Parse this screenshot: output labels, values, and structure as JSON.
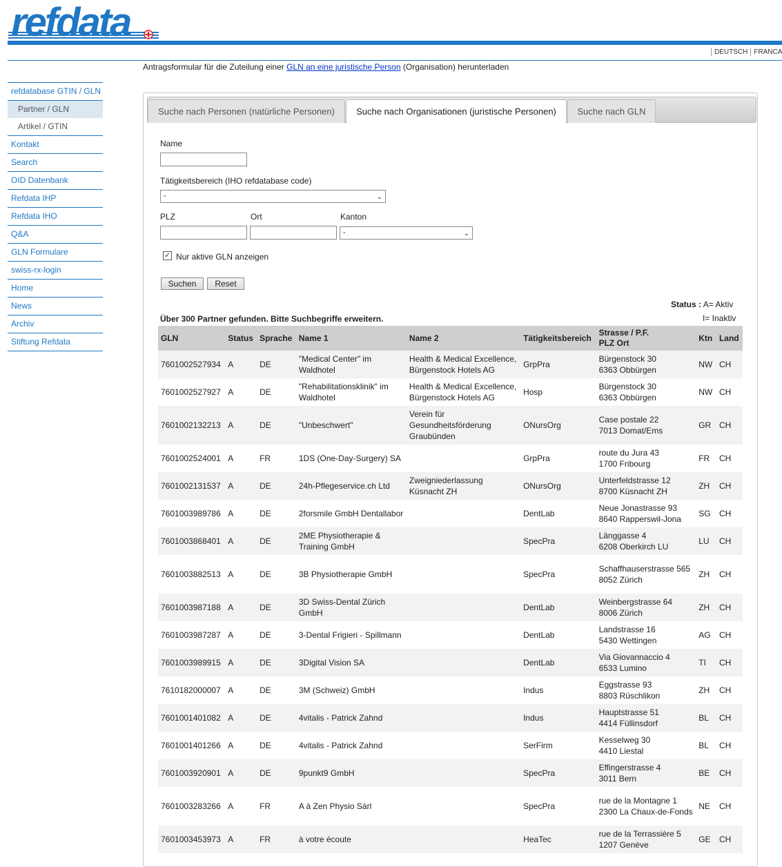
{
  "header": {
    "logo_text": "refdata",
    "languages": [
      "DEUTSCH",
      "FRANCAIS"
    ]
  },
  "download": {
    "prefix": "Antragsformular für die Zuteilung einer ",
    "link": "GLN an eine juristische Person",
    "suffix": " (Organisation) herunterladen"
  },
  "sidebar": {
    "items": [
      {
        "label": "refdatabase GTIN / GLN"
      },
      {
        "label": "Partner / GLN"
      },
      {
        "label": "Artikel / GTIN"
      },
      {
        "label": "Kontakt"
      },
      {
        "label": "Search"
      },
      {
        "label": "OID Datenbank"
      },
      {
        "label": "Refdata IHP"
      },
      {
        "label": "Refdata IHO"
      },
      {
        "label": "Q&A"
      },
      {
        "label": "GLN Formulare"
      },
      {
        "label": "swiss-rx-login"
      },
      {
        "label": "Home"
      },
      {
        "label": "News"
      },
      {
        "label": "Archiv"
      },
      {
        "label": "Stiftung Refdata"
      }
    ]
  },
  "tabs": [
    {
      "label": "Suche nach Personen (natürliche Personen)"
    },
    {
      "label": "Suche nach Organisationen (juristische Personen)"
    },
    {
      "label": "Suche nach GLN"
    }
  ],
  "form": {
    "name_label": "Name",
    "name_value": "",
    "activity_label": "Tätigkeitsbereich (IHO refdatabase code)",
    "activity_value": "-",
    "plz_label": "PLZ",
    "ort_label": "Ort",
    "kanton_label": "Kanton",
    "kanton_value": "-",
    "active_only_label": "Nur aktive GLN anzeigen",
    "active_only_checked": "✓",
    "search_button": "Suchen",
    "reset_button": "Reset"
  },
  "status_legend": {
    "title": "Status :",
    "a": "A= Aktiv",
    "i": "I=  Inaktiv"
  },
  "result_message": "Über 300 Partner gefunden. Bitte Suchbegriffe erweitern.",
  "table": {
    "headers": [
      "GLN",
      "Status",
      "Sprache",
      "Name 1",
      "Name 2",
      "Tätigkeitsbereich",
      "Strasse / P.F.\nPLZ Ort",
      "Ktn",
      "Land"
    ],
    "rows": [
      [
        "7601002527934",
        "A",
        "DE",
        "\"Medical Center\" im Waldhotel",
        "Health & Medical Excellence, Bürgenstock Hotels AG",
        "GrpPra",
        "Bürgenstock 30\n6363 Obbürgen",
        "NW",
        "CH"
      ],
      [
        "7601002527927",
        "A",
        "DE",
        "\"Rehabilitationsklinik\" im Waldhotel",
        "Health & Medical Excellence, Bürgenstock Hotels AG",
        "Hosp",
        "Bürgenstock 30\n6363 Obbürgen",
        "NW",
        "CH"
      ],
      [
        "7601002132213",
        "A",
        "DE",
        "\"Unbeschwert\"",
        "Verein für Gesundheitsförderung Graubünden",
        "ONursOrg",
        "Case postale 22\n7013 Domat/Ems",
        "GR",
        "CH"
      ],
      [
        "7601002524001",
        "A",
        "FR",
        "1DS (One-Day-Surgery) SA",
        "",
        "GrpPra",
        "route du Jura 43\n1700 Fribourg",
        "FR",
        "CH"
      ],
      [
        "7601002131537",
        "A",
        "DE",
        "24h-Pflegeservice.ch Ltd",
        "Zweigniederlassung Küsnacht ZH",
        "ONursOrg",
        "Unterfeldstrasse 12\n8700 Küsnacht ZH",
        "ZH",
        "CH"
      ],
      [
        "7601003989786",
        "A",
        "DE",
        "2forsmile GmbH Dentallabor",
        "",
        "DentLab",
        "Neue Jonastrasse 93\n8640 Rapperswil-Jona",
        "SG",
        "CH"
      ],
      [
        "7601003868401",
        "A",
        "DE",
        "2ME Physiotherapie & Training GmbH",
        "",
        "SpecPra",
        "Länggasse 4\n6208 Oberkirch LU",
        "LU",
        "CH"
      ],
      [
        "7601003882513",
        "A",
        "DE",
        "3B Physiotherapie GmbH",
        "",
        "SpecPra",
        "Schaffhauserstrasse 565\n8052 Zürich",
        "ZH",
        "CH"
      ],
      [
        "7601003987188",
        "A",
        "DE",
        "3D Swiss-Dental Zürich GmbH",
        "",
        "DentLab",
        "Weinbergstrasse 64\n8006 Zürich",
        "ZH",
        "CH"
      ],
      [
        "7601003987287",
        "A",
        "DE",
        "3-Dental Frigieri - Spillmann",
        "",
        "DentLab",
        "Landstrasse 16\n5430 Wettingen",
        "AG",
        "CH"
      ],
      [
        "7601003989915",
        "A",
        "DE",
        "3Digital Vision SA",
        "",
        "DentLab",
        "Via Giovannaccio 4\n6533 Lumino",
        "TI",
        "CH"
      ],
      [
        "7610182000007",
        "A",
        "DE",
        "3M (Schweiz) GmbH",
        "",
        "Indus",
        "Eggstrasse 93\n8803 Rüschlikon",
        "ZH",
        "CH"
      ],
      [
        "7601001401082",
        "A",
        "DE",
        "4vitalis - Patrick Zahnd",
        "",
        "Indus",
        "Hauptstrasse 51\n4414 Füllinsdorf",
        "BL",
        "CH"
      ],
      [
        "7601001401266",
        "A",
        "DE",
        "4vitalis - Patrick Zahnd",
        "",
        "SerFirm",
        "Kesselweg 30\n4410 Liestal",
        "BL",
        "CH"
      ],
      [
        "7601003920901",
        "A",
        "DE",
        "9punkt9 GmbH",
        "",
        "SpecPra",
        "Effingerstrasse 4\n3011 Bern",
        "BE",
        "CH"
      ],
      [
        "7601003283266",
        "A",
        "FR",
        "A à Zen Physio Sàrl",
        "",
        "SpecPra",
        "rue de la Montagne 1\n2300 La Chaux-de-Fonds",
        "NE",
        "CH"
      ],
      [
        "7601003453973",
        "A",
        "FR",
        "à votre écoute",
        "",
        "HeaTec",
        "rue de la Terrassière 5\n1207 Genève",
        "GE",
        "CH"
      ]
    ]
  }
}
